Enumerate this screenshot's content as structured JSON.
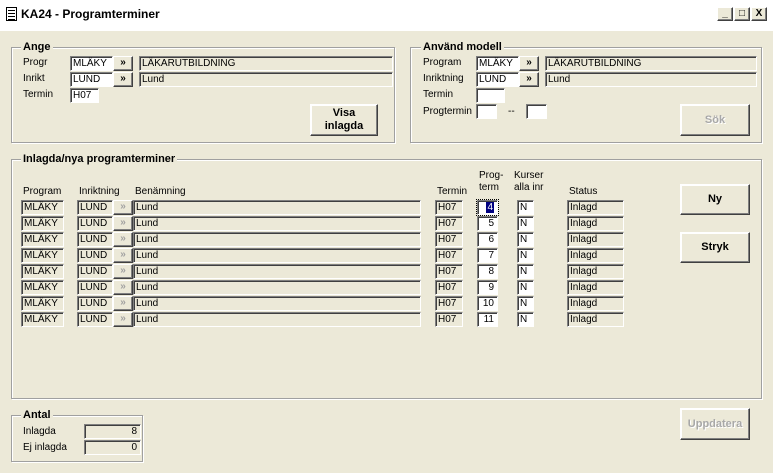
{
  "window": {
    "title": "KA24 - Programterminer",
    "min": "_",
    "max": "□",
    "close": "X"
  },
  "ange": {
    "legend": "Ange",
    "progr_label": "Progr",
    "progr_value": "MLÄKY",
    "progr_name": "LÄKARUTBILDNING",
    "inrikt_label": "Inrikt",
    "inrikt_value": "LUND",
    "inrikt_name": "Lund",
    "termin_label": "Termin",
    "termin_value": "H07",
    "arrow": "»",
    "visa_line1": "Visa",
    "visa_line2": "inlagda"
  },
  "modell": {
    "legend": "Använd modell",
    "program_label": "Program",
    "program_value": "MLÄKY",
    "program_name": "LÄKARUTBILDNING",
    "inriktning_label": "Inriktning",
    "inriktning_value": "LUND",
    "inriktning_name": "Lund",
    "termin_label": "Termin",
    "termin_value": "",
    "progtermin_label": "Progtermin",
    "progtermin_from": "",
    "progtermin_sep": "--",
    "progtermin_to": "",
    "sok_label": "Sök"
  },
  "list": {
    "legend": "Inlagda/nya programterminer",
    "headers": {
      "program": "Program",
      "inriktning": "Inriktning",
      "benamning": "Benämning",
      "termin": "Termin",
      "progterm1": "Prog-",
      "progterm2": "term",
      "kurser1": "Kurser",
      "kurser2": "alla inr",
      "status": "Status"
    },
    "rows": [
      {
        "program": "MLÄKY",
        "inriktning": "LUND",
        "btn": "»",
        "benamning": "Lund",
        "termin": "H07",
        "progterm": "4",
        "kurser": "N",
        "status": "Inlagd"
      },
      {
        "program": "MLÄKY",
        "inriktning": "LUND",
        "btn": "»",
        "benamning": "Lund",
        "termin": "H07",
        "progterm": "5",
        "kurser": "N",
        "status": "Inlagd"
      },
      {
        "program": "MLÄKY",
        "inriktning": "LUND",
        "btn": "»",
        "benamning": "Lund",
        "termin": "H07",
        "progterm": "6",
        "kurser": "N",
        "status": "Inlagd"
      },
      {
        "program": "MLÄKY",
        "inriktning": "LUND",
        "btn": "»",
        "benamning": "Lund",
        "termin": "H07",
        "progterm": "7",
        "kurser": "N",
        "status": "Inlagd"
      },
      {
        "program": "MLÄKY",
        "inriktning": "LUND",
        "btn": "»",
        "benamning": "Lund",
        "termin": "H07",
        "progterm": "8",
        "kurser": "N",
        "status": "Inlagd"
      },
      {
        "program": "MLÄKY",
        "inriktning": "LUND",
        "btn": "»",
        "benamning": "Lund",
        "termin": "H07",
        "progterm": "9",
        "kurser": "N",
        "status": "Inlagd"
      },
      {
        "program": "MLÄKY",
        "inriktning": "LUND",
        "btn": "»",
        "benamning": "Lund",
        "termin": "H07",
        "progterm": "10",
        "kurser": "N",
        "status": "Inlagd"
      },
      {
        "program": "MLÄKY",
        "inriktning": "LUND",
        "btn": "»",
        "benamning": "Lund",
        "termin": "H07",
        "progterm": "11",
        "kurser": "N",
        "status": "Inlagd"
      }
    ],
    "ny_label": "Ny",
    "stryk_label": "Stryk"
  },
  "antal": {
    "legend": "Antal",
    "inlagda_label": "Inlagda",
    "inlagda_value": "8",
    "ej_label": "Ej inlagda",
    "ej_value": "0"
  },
  "uppdatera_label": "Uppdatera"
}
